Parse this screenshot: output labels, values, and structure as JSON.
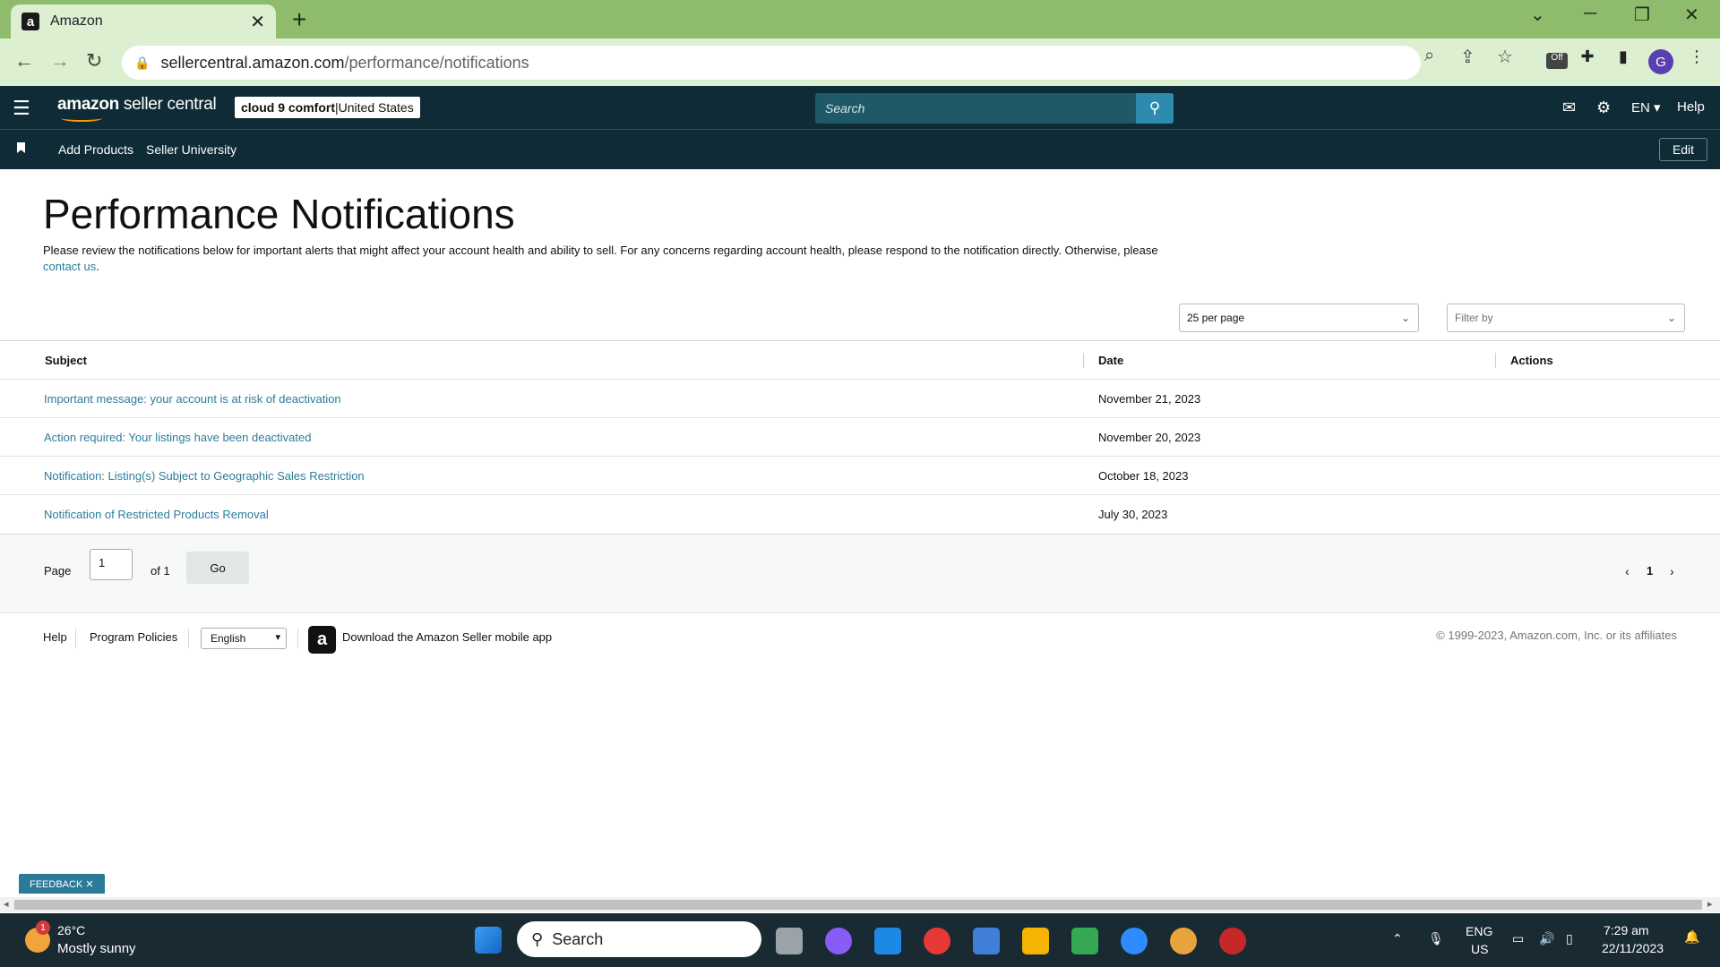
{
  "browser": {
    "tab_title": "Amazon",
    "favicon": "a",
    "url_domain": "sellercentral.amazon.com",
    "url_path": "/performance/notifications",
    "extension_badge": "Off",
    "profile_initial": "G"
  },
  "header": {
    "logo_brand": "amazon",
    "logo_product": " seller central",
    "store_name": "cloud 9 comfort",
    "store_separator": " | ",
    "store_region": "United States",
    "search_placeholder": "Search",
    "language": "EN",
    "help": "Help"
  },
  "subnav": {
    "items": [
      "Add Products",
      "Seller University"
    ],
    "edit": "Edit"
  },
  "page": {
    "title": "Performance Notifications",
    "intro_text": "Please review the notifications below for important alerts that might affect your account health and ability to sell. For any concerns regarding account health, please respond to the notification directly. Otherwise, please ",
    "intro_link": "contact us",
    "intro_end": ".",
    "per_page": "25 per page",
    "filter_placeholder": "Filter by"
  },
  "table": {
    "columns": [
      "Subject",
      "Date",
      "Actions"
    ],
    "rows": [
      {
        "subject": "Important message: your account is at risk of deactivation",
        "date": "November 21, 2023"
      },
      {
        "subject": "Action required: Your listings have been deactivated",
        "date": "November 20, 2023"
      },
      {
        "subject": "Notification: Listing(s) Subject to Geographic Sales Restriction",
        "date": "October 18, 2023"
      },
      {
        "subject": "Notification of Restricted Products Removal",
        "date": "July 30, 2023"
      }
    ]
  },
  "pagination": {
    "page_label": "Page",
    "page_value": "1",
    "of_label": "of 1",
    "go": "Go",
    "current": "1"
  },
  "footer": {
    "help": "Help",
    "policies": "Program Policies",
    "language": "English",
    "app_text": "Download the Amazon Seller mobile app",
    "copyright": "© 1999-2023, Amazon.com, Inc. or its affiliates"
  },
  "feedback": "FEEDBACK ✕",
  "taskbar": {
    "weather_badge": "1",
    "temperature": "26°C",
    "condition": "Mostly sunny",
    "search": "Search",
    "lang_top": "ENG",
    "lang_bottom": "US",
    "time": "7:29 am",
    "date": "22/11/2023"
  },
  "colors": {
    "header_bg": "#0f2b36",
    "link": "#2c7c9c",
    "tabbar": "#8ebc6c"
  }
}
